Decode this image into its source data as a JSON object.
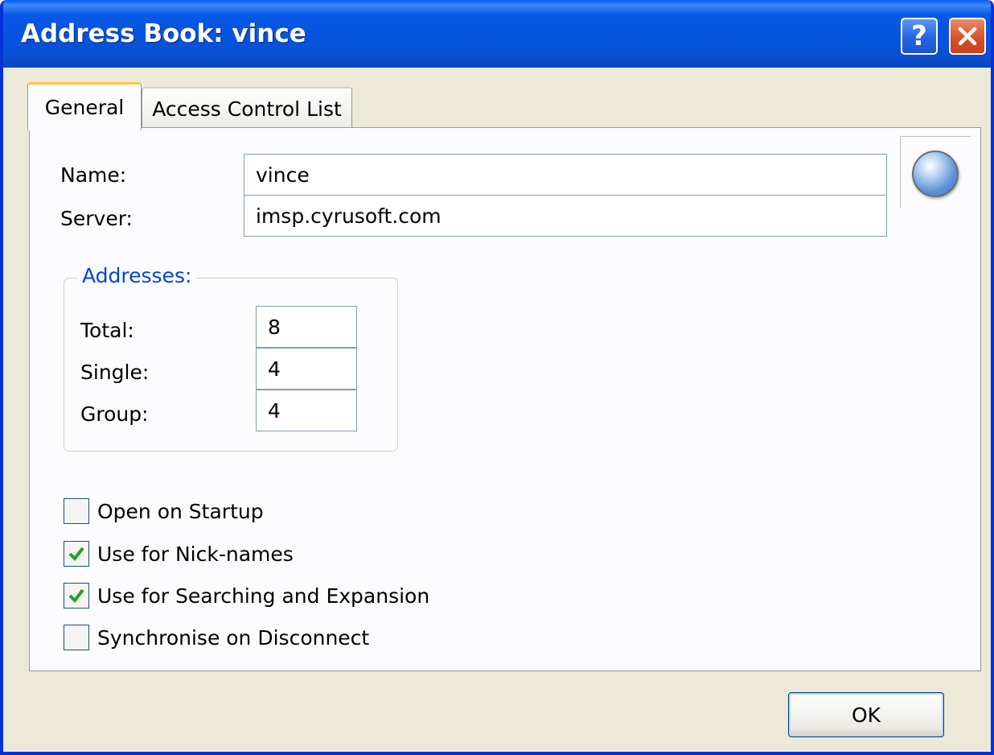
{
  "window": {
    "title": "Address Book: vince",
    "help_glyph": "?",
    "close_icon": "close-icon"
  },
  "tabs": [
    {
      "label": "General",
      "selected": true
    },
    {
      "label": "Access Control List",
      "selected": false
    }
  ],
  "general": {
    "name_label": "Name:",
    "name_value": "vince",
    "server_label": "Server:",
    "server_value": "imsp.cyrusoft.com",
    "icon": "globe-icon",
    "addresses": {
      "title": "Addresses:",
      "total_label": "Total:",
      "total_value": "8",
      "single_label": "Single:",
      "single_value": "4",
      "group_label": "Group:",
      "group_value": "4"
    },
    "options": [
      {
        "label": "Open on Startup",
        "checked": false
      },
      {
        "label": "Use for Nick-names",
        "checked": true
      },
      {
        "label": "Use for Searching and Expansion",
        "checked": true
      },
      {
        "label": "Synchronise on Disconnect",
        "checked": false
      }
    ]
  },
  "buttons": {
    "ok": "OK"
  },
  "colors": {
    "title_bar": "#0553dc",
    "group_title": "#0046d5",
    "check": "#21a121",
    "dialog_bg": "#ece9d8"
  }
}
